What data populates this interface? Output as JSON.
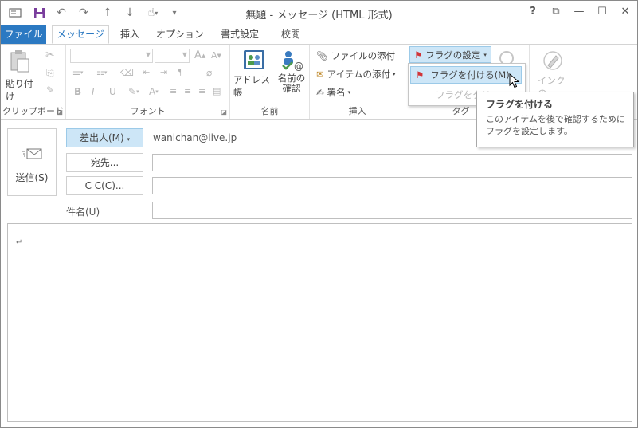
{
  "window": {
    "title": "無題 - メッセージ (HTML 形式)"
  },
  "qat": {
    "icons": [
      "outlook-icon",
      "save-icon",
      "undo-icon",
      "redo-icon",
      "up-arrow-icon",
      "down-arrow-icon",
      "touch-mode-icon",
      "customize-icon"
    ]
  },
  "window_controls": {
    "help": "?",
    "restore_ribbon": "⧉",
    "minimize": "—",
    "maximize": "☐",
    "close": "✕"
  },
  "tabs": [
    {
      "label": "ファイル"
    },
    {
      "label": "メッセージ"
    },
    {
      "label": "挿入"
    },
    {
      "label": "オプション"
    },
    {
      "label": "書式設定"
    },
    {
      "label": "校閲"
    }
  ],
  "ribbon": {
    "clipboard": {
      "paste": "貼り付け",
      "label": "クリップボード"
    },
    "font": {
      "label": "フォント",
      "bold": "B",
      "italic": "I",
      "underline": "U",
      "font_color": "A",
      "grow": "A",
      "shrink": "A"
    },
    "names": {
      "address_book": "アドレス帳",
      "check_names_line1": "名前の",
      "check_names_line2": "確認",
      "label": "名前"
    },
    "insert": {
      "attach_file": "ファイルの添付",
      "attach_item": "アイテムの添付",
      "signature": "署名",
      "label": "挿入"
    },
    "tags": {
      "follow_up": "フラグの設定",
      "label": "タグ"
    },
    "ink": {
      "label": "インクの"
    }
  },
  "flag_menu": {
    "items": [
      {
        "label": "フラグを付ける(M)"
      },
      {
        "label": "フラグをクリ"
      }
    ]
  },
  "tooltip": {
    "title": "フラグを付ける",
    "body": "このアイテムを後で確認するためにフラグを設定します。"
  },
  "compose": {
    "send": "送信(S)",
    "from_button": "差出人(M)",
    "from_value": "wanichan@live.jp",
    "to_button": "宛先...",
    "cc_button": "C C(C)...",
    "subject_label": "件名(U)",
    "body_mark": "↵"
  },
  "colors": {
    "accent": "#2b79c2",
    "highlight": "#cde6f7",
    "flag_red": "#d13438"
  }
}
